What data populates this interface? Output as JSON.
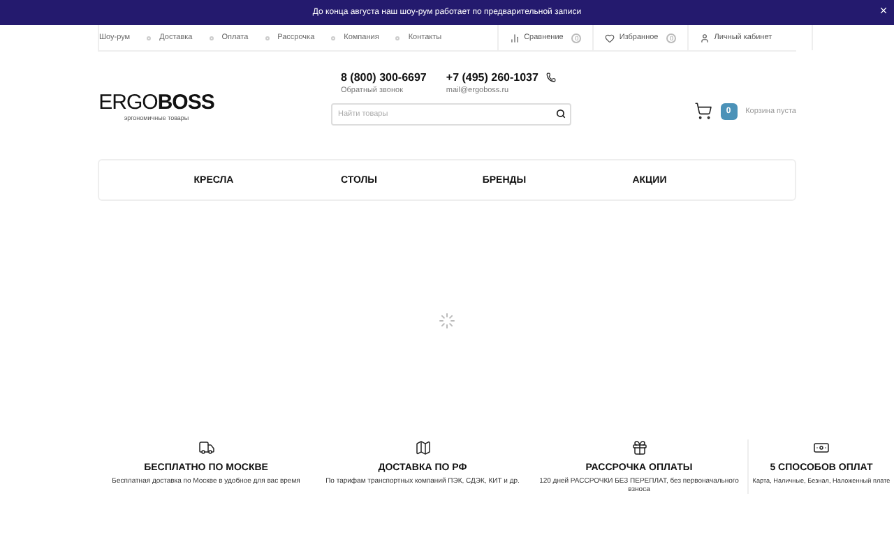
{
  "announcement": {
    "text": "До конца августа наш шоу-рум работает по предварительной записи"
  },
  "top_nav": {
    "links": [
      "Шоу-рум",
      "Доставка",
      "Оплата",
      "Рассрочка",
      "Компания",
      "Контакты"
    ],
    "tools": [
      {
        "kind": "compare",
        "label": "Сравнение",
        "count": "0"
      },
      {
        "kind": "favorites",
        "label": "Избранное",
        "count": "0"
      },
      {
        "kind": "account",
        "label": "Личный кабинет"
      }
    ]
  },
  "header": {
    "logo": {
      "light": "ERGO",
      "bold": "BOSS",
      "tagline": "эргономичные товары"
    },
    "phones": [
      {
        "number": "8 (800) 300-6697",
        "note": "Обратный звонок",
        "whatsapp": false
      },
      {
        "number": "+7 (495) 260-1037",
        "note": "mail@ergoboss.ru",
        "whatsapp": true
      }
    ],
    "search": {
      "placeholder": "Найти товары"
    },
    "cart": {
      "count": "0",
      "label": "Корзина пуста"
    }
  },
  "menu": [
    "КРЕСЛА",
    "СТОЛЫ",
    "БРЕНДЫ",
    "АКЦИИ"
  ],
  "features": [
    {
      "kind": "truck",
      "title": "БЕСПЛАТНО ПО МОСКВЕ",
      "text": "Бесплатная доставка по Москве в удобное для вас время"
    },
    {
      "kind": "map",
      "title": "ДОСТАВКА ПО РФ",
      "text": "По тарифам транспортных компаний ПЭК, СДЭК, КИТ и др."
    },
    {
      "kind": "gift",
      "title": "РАССРОЧКА ОПЛАТЫ",
      "text": "120 дней РАССРОЧКИ БЕЗ ПЕРЕПЛАТ, без первоначального взноса"
    },
    {
      "kind": "money",
      "title": "5 СПОСОБОВ ОПЛАТ",
      "text": "Карта, Наличные, Безнал, Наложенный плате"
    }
  ]
}
